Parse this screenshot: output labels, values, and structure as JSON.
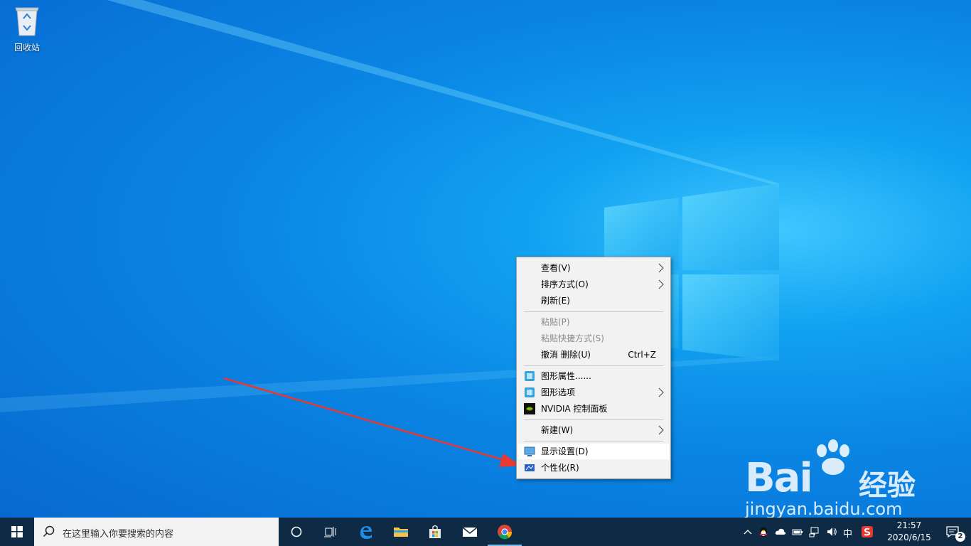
{
  "desktop": {
    "recycle_bin_label": "回收站"
  },
  "context_menu": {
    "items": [
      {
        "label": "查看(V)",
        "submenu": true
      },
      {
        "label": "排序方式(O)",
        "submenu": true
      },
      {
        "label": "刷新(E)"
      },
      {
        "label": "粘贴(P)",
        "disabled": true
      },
      {
        "label": "粘贴快捷方式(S)",
        "disabled": true
      },
      {
        "label": "撤消 删除(U)",
        "shortcut": "Ctrl+Z"
      },
      {
        "label": "图形属性......",
        "icon": "intel-graphics-icon"
      },
      {
        "label": "图形选项",
        "icon": "intel-graphics-icon",
        "submenu": true
      },
      {
        "label": "NVIDIA 控制面板",
        "icon": "nvidia-icon"
      },
      {
        "label": "新建(W)",
        "submenu": true
      },
      {
        "label": "显示设置(D)",
        "icon": "display-icon",
        "highlighted": true
      },
      {
        "label": "个性化(R)",
        "icon": "personalize-icon"
      }
    ]
  },
  "taskbar": {
    "search_placeholder": "在这里输入你要搜索的内容",
    "ime": "中",
    "time": "21:57",
    "date": "2020/6/15",
    "notification_count": "2"
  },
  "watermark": {
    "brand": "Bai",
    "suffix": "经验",
    "url": "jingyan.baidu.com"
  },
  "colors": {
    "taskbar": "#0e2a44",
    "menu": "#f2f2f2",
    "arrow": "#e8382f"
  }
}
